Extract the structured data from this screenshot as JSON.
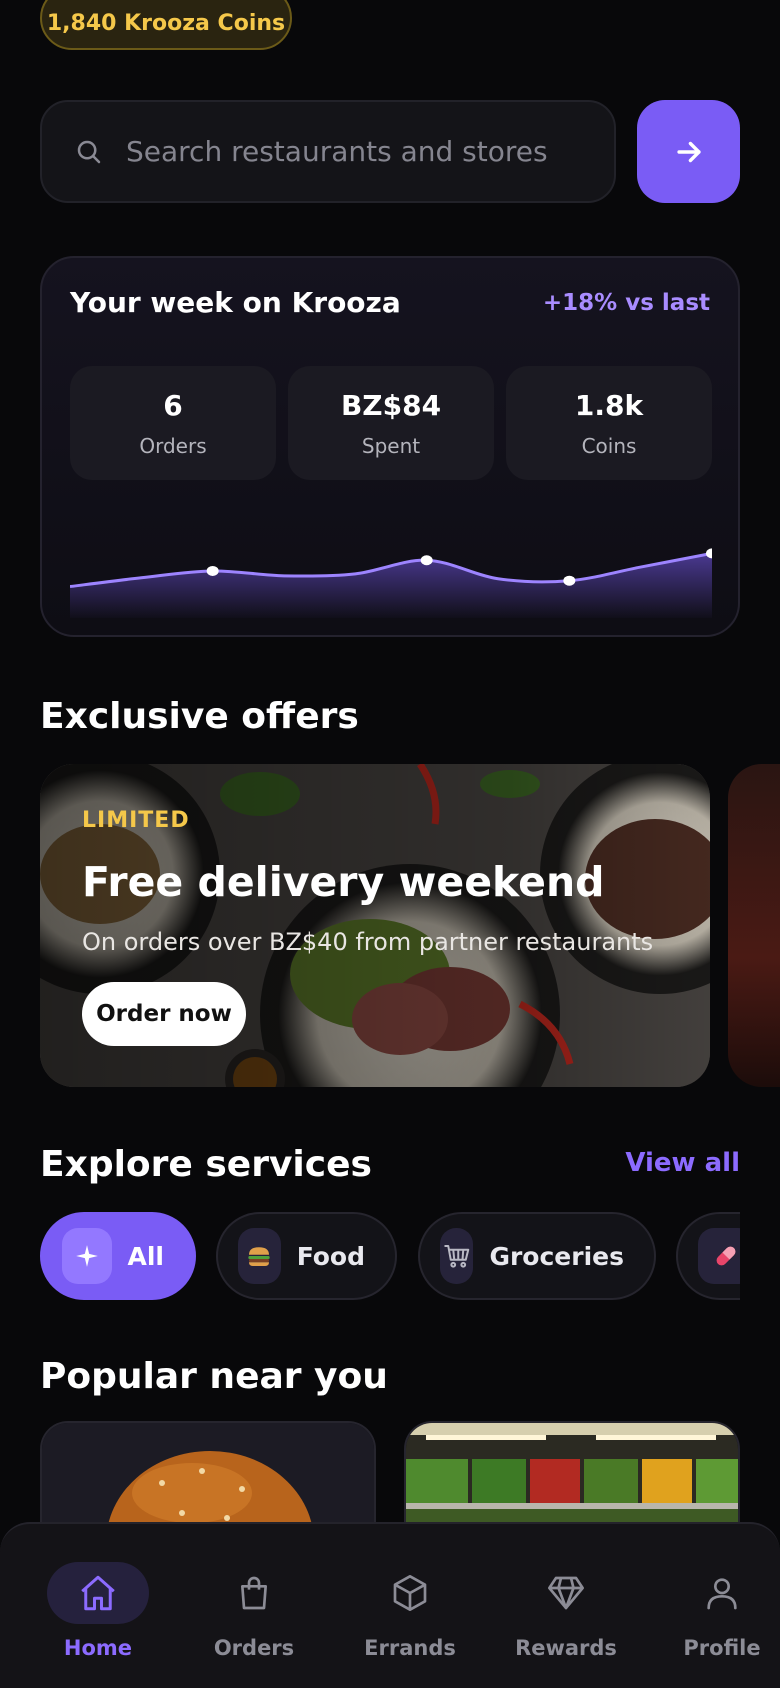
{
  "header": {
    "coins_label": "1,840 Krooza Coins"
  },
  "search": {
    "placeholder": "Search restaurants and stores"
  },
  "week": {
    "title": "Your week on Krooza",
    "delta": "+18% vs last",
    "stats": [
      {
        "value": "6",
        "label": "Orders"
      },
      {
        "value": "BZ$84",
        "label": "Spent"
      },
      {
        "value": "1.8k",
        "label": "Coins"
      }
    ]
  },
  "chart_data": {
    "type": "area",
    "series": [
      {
        "values": [
          22,
          31,
          38,
          33,
          35,
          49,
          30,
          28,
          42,
          56
        ]
      }
    ],
    "highlighted_points": [
      3,
      6,
      10
    ],
    "ylim": [
      0,
      80
    ],
    "grid": false,
    "color": "#9d84ff"
  },
  "offers": {
    "title": "Exclusive offers",
    "tag": "LIMITED",
    "headline": "Free delivery weekend",
    "subtitle": "On orders over BZ$40 from partner restaurants",
    "cta": "Order now"
  },
  "services": {
    "title": "Explore services",
    "view_all": "View all",
    "chips": [
      {
        "label": "All",
        "icon": "sparkle-icon",
        "active": true
      },
      {
        "label": "Food",
        "icon": "burger-icon"
      },
      {
        "label": "Groceries",
        "icon": "cart-icon"
      },
      {
        "label": "",
        "icon": "pill-icon"
      }
    ]
  },
  "popular": {
    "title": "Popular near you"
  },
  "nav": {
    "items": [
      {
        "label": "Home",
        "icon": "home-icon",
        "active": true
      },
      {
        "label": "Orders",
        "icon": "bag-icon"
      },
      {
        "label": "Errands",
        "icon": "box-icon"
      },
      {
        "label": "Rewards",
        "icon": "diamond-icon"
      },
      {
        "label": "Profile",
        "icon": "user-icon"
      }
    ]
  },
  "colors": {
    "accent": "#7a5cf5",
    "gold": "#f5c84a",
    "background": "#08080a"
  }
}
